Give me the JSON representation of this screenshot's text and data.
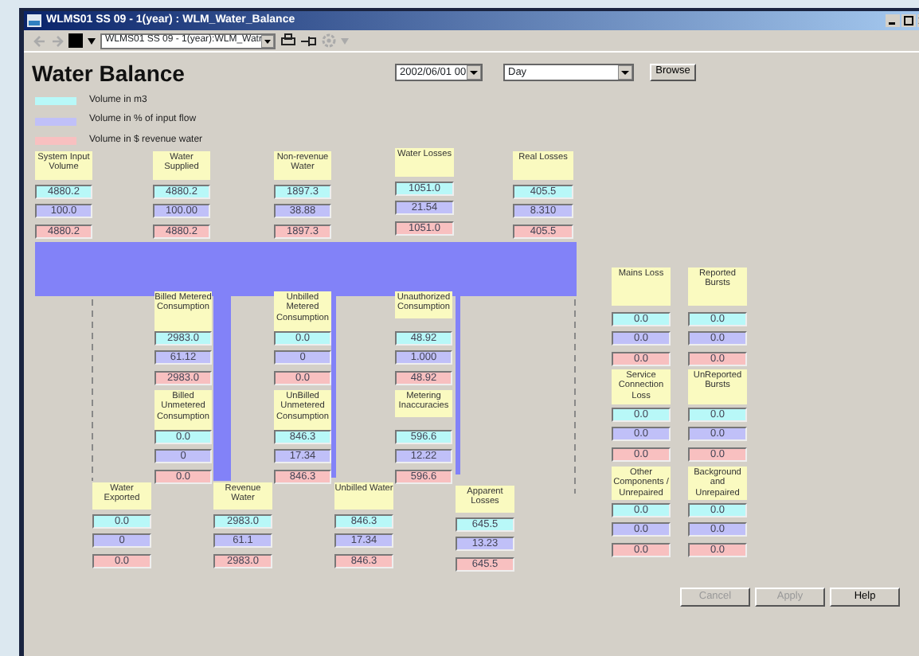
{
  "window": {
    "title": "WLMS01 SS 09 - 1(year) : WLM_Water_Balance"
  },
  "toolbar": {
    "combo": "WLMS01  SS 09 - 1(year):WLM_Watr"
  },
  "heading": "Water Balance",
  "date_select": "2002/06/01 00",
  "period_select": "Day",
  "browse_button": "Browse",
  "legend": [
    {
      "label": "Volume in m3",
      "color": "#b8f8f8"
    },
    {
      "label": "Volume in % of input flow",
      "color": "#c0c0f8"
    },
    {
      "label": "Volume in $ revenue water",
      "color": "#f8c0c0"
    }
  ],
  "nodes": [
    {
      "label": "System Input Volume",
      "values": [
        "4880.2",
        "100.0",
        "4880.2"
      ]
    },
    {
      "label": "Water Supplied",
      "values": [
        "4880.2",
        "100.00",
        "4880.2"
      ]
    },
    {
      "label": "Non-revenue Water",
      "values": [
        "1897.3",
        "38.88",
        "1897.3"
      ]
    },
    {
      "label": "Water Losses",
      "values": [
        "1051.0",
        "21.54",
        "1051.0"
      ]
    },
    {
      "label": "Real Losses",
      "values": [
        "405.5",
        "8.310",
        "405.5"
      ]
    },
    {
      "label": "Billed Metered Consumption",
      "values": [
        "2983.0",
        "61.12",
        "2983.0"
      ]
    },
    {
      "label": "Unbilled Metered Consumption",
      "values": [
        "0.0",
        "0",
        "0.0"
      ]
    },
    {
      "label": "Unauthorized Consumption",
      "values": [
        "48.92",
        "1.000",
        "48.92"
      ]
    },
    {
      "label": "Billed Unmetered Consumption",
      "values": [
        "0.0",
        "0",
        "0.0"
      ]
    },
    {
      "label": "UnBilled Unmetered Consumption",
      "values": [
        "846.3",
        "17.34",
        "846.3"
      ]
    },
    {
      "label": "Metering Inaccuracies",
      "values": [
        "596.6",
        "12.22",
        "596.6"
      ]
    },
    {
      "label": "Water Exported",
      "values": [
        "0.0",
        "0",
        "0.0"
      ]
    },
    {
      "label": "Revenue Water",
      "values": [
        "2983.0",
        "61.1",
        "2983.0"
      ]
    },
    {
      "label": "Unbilled Water",
      "values": [
        "846.3",
        "17.34",
        "846.3"
      ]
    },
    {
      "label": "Apparent Losses",
      "values": [
        "645.5",
        "13.23",
        "645.5"
      ]
    },
    {
      "label": "Mains Loss",
      "values": [
        "0.0",
        "0.0",
        "0.0"
      ]
    },
    {
      "label": "Reported Bursts",
      "values": [
        "0.0",
        "0.0",
        "0.0"
      ]
    },
    {
      "label": "Service Connection Loss",
      "values": [
        "0.0",
        "0.0",
        "0.0"
      ]
    },
    {
      "label": "UnReported Bursts",
      "values": [
        "0.0",
        "0.0",
        "0.0"
      ]
    },
    {
      "label": "Other Components / Unrepaired",
      "values": [
        "0.0",
        "0.0",
        "0.0"
      ]
    },
    {
      "label": "Background and Unrepaired",
      "values": [
        "0.0",
        "0.0",
        "0.0"
      ]
    }
  ],
  "buttons": [
    {
      "label": "Cancel",
      "disabled": true
    },
    {
      "label": "Apply",
      "disabled": true
    },
    {
      "label": "Help",
      "disabled": false
    }
  ]
}
